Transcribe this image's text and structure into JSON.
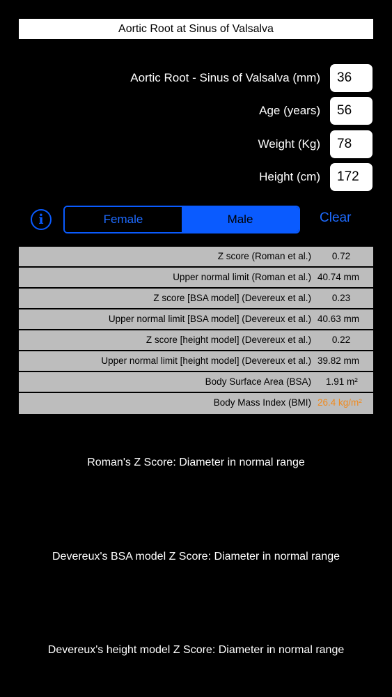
{
  "title": "Aortic Root at Sinus of Valsalva",
  "inputs": [
    {
      "label": "Aortic Root - Sinus of Valsalva (mm)",
      "value": "36"
    },
    {
      "label": "Age (years)",
      "value": "56"
    },
    {
      "label": "Weight (Kg)",
      "value": "78"
    },
    {
      "label": "Height (cm)",
      "value": "172"
    }
  ],
  "info_icon": "info-circle-icon",
  "sex_selector": {
    "options": [
      "Female",
      "Male"
    ],
    "selected": "Male"
  },
  "clear_label": "Clear",
  "results": [
    {
      "label": "Z score (Roman et al.)",
      "value": "0.72"
    },
    {
      "label": "Upper normal limit (Roman et al.)",
      "value": "40.74 mm"
    },
    {
      "label": "Z score [BSA model] (Devereux et al.)",
      "value": "0.23"
    },
    {
      "label": "Upper normal limit [BSA model] (Devereux et al.)",
      "value": "40.63 mm"
    },
    {
      "label": "Z score [height model] (Devereux et al.)",
      "value": "0.22"
    },
    {
      "label": "Upper normal limit [height model] (Devereux et al.)",
      "value": "39.82 mm"
    },
    {
      "label": "Body Surface Area (BSA)",
      "value": "1.91 m²"
    },
    {
      "label": "Body Mass Index (BMI)",
      "value": "26.4 kg/m²"
    }
  ],
  "summaries": [
    "Roman's Z Score:  Diameter in normal range",
    "Devereux's BSA model Z Score:  Diameter in normal range",
    "Devereux's height model Z Score:  Diameter in normal range"
  ],
  "colors": {
    "accent": "#0a5bff",
    "warning": "#f08a1d",
    "table_bg": "#bdbdbd"
  }
}
